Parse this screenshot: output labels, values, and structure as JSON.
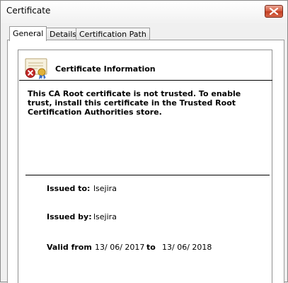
{
  "window": {
    "title": "Certificate"
  },
  "tabs": [
    {
      "label": "General"
    },
    {
      "label": "Details"
    },
    {
      "label": "Certification Path"
    }
  ],
  "info": {
    "heading": "Certificate Information",
    "warning": "This CA Root certificate is not trusted. To enable trust, install this certificate in the Trusted Root Certification Authorities store.",
    "issued_to_label": "Issued to:",
    "issued_to_value": "lsejira",
    "issued_by_label": "Issued by:",
    "issued_by_value": "lsejira",
    "valid_from_label": "Valid from",
    "valid_from_value": "13/ 06/ 2017",
    "valid_to_label": "to",
    "valid_to_value": "13/ 06/ 2018"
  },
  "colors": {
    "close_button": "#c8432a",
    "error_badge": "#c62828",
    "seal": "#e0b13a"
  },
  "icons": {
    "close": "close-icon",
    "certificate": "certificate-error-icon"
  }
}
